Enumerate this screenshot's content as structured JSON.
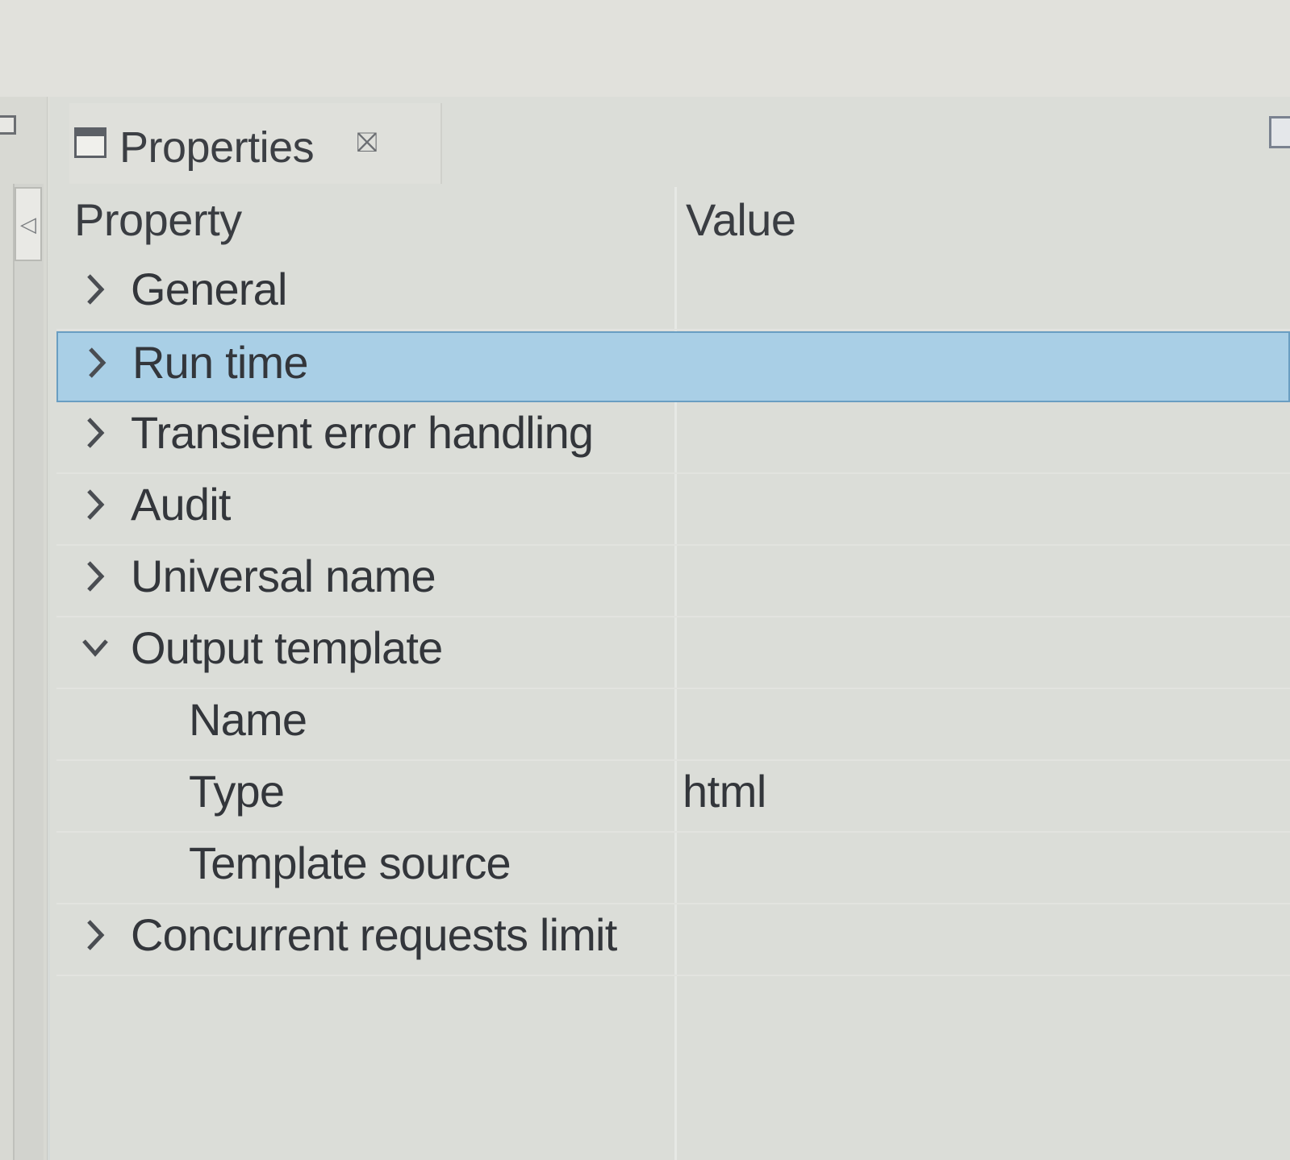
{
  "view": {
    "tab_title": "Properties",
    "tab_close_glyph": "⛝",
    "icons": {
      "tab": "properties-view-icon",
      "close": "close-icon",
      "scroll_left": "scroll-left-icon"
    }
  },
  "table": {
    "columns": [
      "Property",
      "Value"
    ],
    "rows": [
      {
        "label": "General",
        "value": "",
        "expander": "collapsed",
        "level": 0,
        "selected": false
      },
      {
        "label": "Run time",
        "value": "",
        "expander": "collapsed",
        "level": 0,
        "selected": true
      },
      {
        "label": "Transient error handling",
        "value": "",
        "expander": "collapsed",
        "level": 0,
        "selected": false
      },
      {
        "label": "Audit",
        "value": "",
        "expander": "collapsed",
        "level": 0,
        "selected": false
      },
      {
        "label": "Universal name",
        "value": "",
        "expander": "collapsed",
        "level": 0,
        "selected": false
      },
      {
        "label": "Output template",
        "value": "",
        "expander": "expanded",
        "level": 0,
        "selected": false
      },
      {
        "label": "Name",
        "value": "",
        "expander": "none",
        "level": 1,
        "selected": false
      },
      {
        "label": "Type",
        "value": "html",
        "expander": "none",
        "level": 1,
        "selected": false
      },
      {
        "label": "Template source",
        "value": "",
        "expander": "none",
        "level": 1,
        "selected": false
      },
      {
        "label": "Concurrent requests limit",
        "value": "",
        "expander": "collapsed",
        "level": 0,
        "selected": false
      }
    ]
  },
  "colors": {
    "selection_fill": "#a9cfe6",
    "selection_border": "#6a9ec2",
    "text": "#33363b"
  }
}
